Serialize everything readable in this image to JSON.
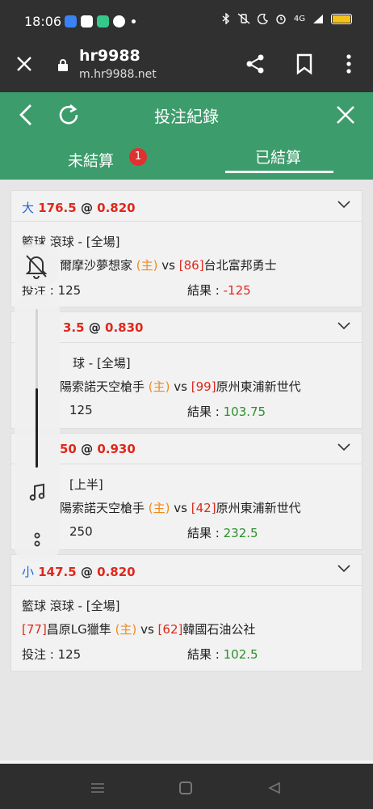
{
  "status": {
    "time": "18:06",
    "network": "4G",
    "left_icons": [
      "download-icon",
      "chat-icon",
      "message-icon",
      "facebook-icon"
    ],
    "right_icons": [
      "bluetooth-icon",
      "vibrate-icon",
      "dnd-moon-icon",
      "alarm-icon",
      "signal-icon",
      "battery-icon"
    ]
  },
  "browser": {
    "title": "hr9988",
    "url": "m.hr9988.net"
  },
  "header": {
    "title": "投注紀錄"
  },
  "tabs": {
    "unsettled_label": "未結算",
    "unsettled_count": "1",
    "settled_label": "已結算"
  },
  "cards": [
    {
      "type": "大",
      "line": "176.5",
      "at": "@",
      "odds": "0.820",
      "sport": "籃球 滾球 - [全場]",
      "home_id": "",
      "home_team": "爾摩沙夢想家",
      "home_tag": "(主)",
      "vs": "vs",
      "away_id": "[86]",
      "away_team": "台北富邦勇士",
      "stake_label": "投注 : 125",
      "result_label": "結果 :",
      "result_value": "-125",
      "outcome": "loss"
    },
    {
      "type": "",
      "line": "3.5",
      "at": "@",
      "odds": "0.830",
      "sport": "球 - [全場]",
      "home_id": "",
      "home_team": "陽索諾天空槍手",
      "home_tag": "(主)",
      "vs": "vs",
      "away_id": "[99]",
      "away_team": "原州東浦新世代",
      "stake_label": "125",
      "result_label": "結果 :",
      "result_value": "103.75",
      "outcome": "win"
    },
    {
      "type": "",
      "line": "50",
      "at": "@",
      "odds": "0.930",
      "sport": "[上半]",
      "home_id": "",
      "home_team": "陽索諾天空槍手",
      "home_tag": "(主)",
      "vs": "vs",
      "away_id": "[42]",
      "away_team": "原州東浦新世代",
      "stake_label": "250",
      "result_label": "結果 :",
      "result_value": "232.5",
      "outcome": "win"
    },
    {
      "type": "小",
      "line": "147.5",
      "at": "@",
      "odds": "0.820",
      "sport": "籃球 滾球 - [全場]",
      "home_id": "[77]",
      "home_team": "昌原LG獵隼",
      "home_tag": "(主)",
      "vs": "vs",
      "away_id": "[62]",
      "away_team": "韓國石油公社",
      "stake_label": "投注 : 125",
      "result_label": "結果 :",
      "result_value": "102.5",
      "outcome": "win"
    }
  ],
  "overlay": {
    "volume_level": 0.5,
    "icons": [
      "mute-bell-icon",
      "music-note-icon",
      "more-dots-icon"
    ]
  },
  "colors": {
    "brand_green": "#3d9c6c",
    "loss_red": "#e0281c",
    "win_green": "#2c8e2c",
    "home_orange": "#f08a1c",
    "bet_type_blue": "#1a63d8"
  }
}
